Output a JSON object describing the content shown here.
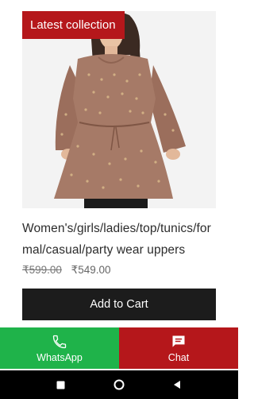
{
  "product": {
    "badge": "Latest collection",
    "image_icon": "product-photo",
    "title": "Women's/girls/ladies/top/tunics/formal/casual/party wear uppers",
    "original_price": "₹599.00",
    "sale_price": "₹549.00",
    "add_to_cart_label": "Add to Cart"
  },
  "contact_bar": {
    "whatsapp_label": "WhatsApp",
    "whatsapp_icon": "phone-icon",
    "whatsapp_color": "#1fb34a",
    "chat_label": "Chat",
    "chat_icon": "chat-bubble-icon",
    "chat_color": "#b5171b"
  },
  "nav_bar": {
    "recents_icon": "square-icon",
    "home_icon": "circle-icon",
    "back_icon": "triangle-back-icon"
  },
  "colors": {
    "accent_red": "#b5171b",
    "button_dark": "#1c1c1c"
  }
}
